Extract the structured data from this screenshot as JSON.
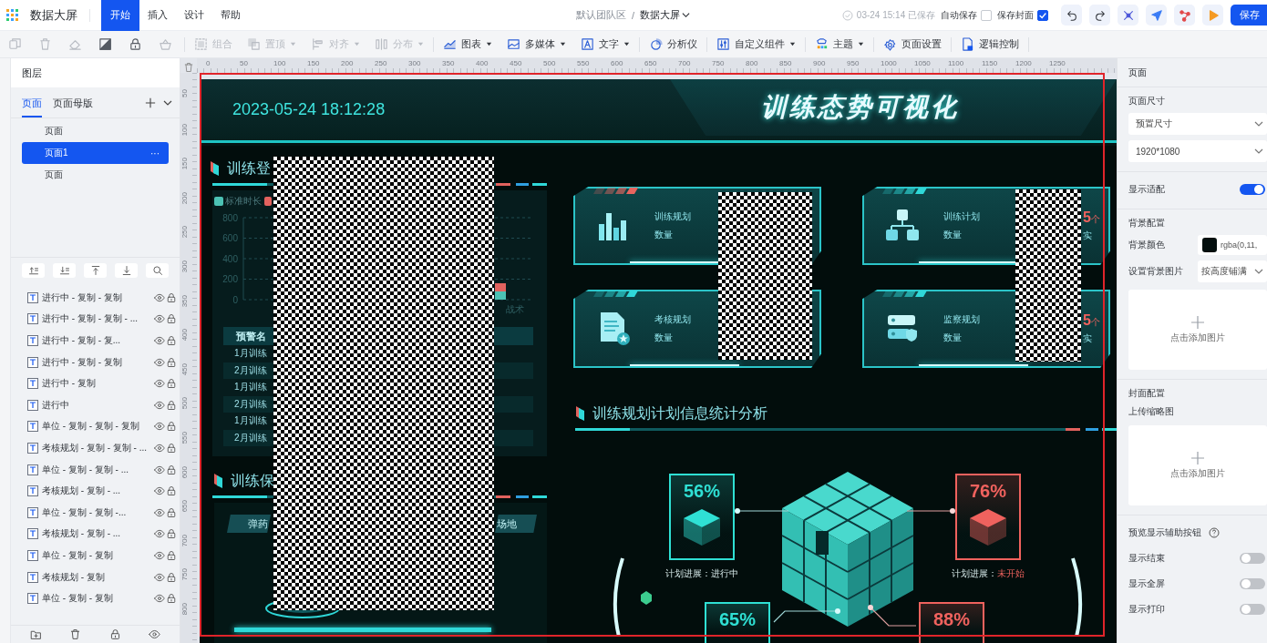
{
  "app": {
    "title": "数据大屏"
  },
  "menu_tabs": [
    {
      "label": "开始",
      "selected": true
    },
    {
      "label": "插入",
      "selected": false
    },
    {
      "label": "设计",
      "selected": false
    },
    {
      "label": "帮助",
      "selected": false
    }
  ],
  "breadcrumb": {
    "team": "默认团队区",
    "separator": "/",
    "page": "数据大屏"
  },
  "save_status": "03-24 15:14 已保存",
  "options": [
    {
      "label": "自动保存",
      "checked": false
    },
    {
      "label": "保存封面",
      "checked": true
    }
  ],
  "top_actions": [
    {
      "kind": "undo"
    },
    {
      "kind": "redo"
    },
    {
      "kind": "focus"
    },
    {
      "kind": "send"
    },
    {
      "kind": "share"
    },
    {
      "kind": "play"
    }
  ],
  "save_button": "保存",
  "toolbar": [
    {
      "items": [
        {
          "kind": "copy",
          "disabled": true
        },
        {
          "kind": "delete",
          "disabled": true
        },
        {
          "kind": "erase",
          "disabled": true
        },
        {
          "kind": "fill",
          "disabled": false
        },
        {
          "kind": "lock",
          "disabled": false
        },
        {
          "kind": "basket",
          "disabled": true
        }
      ]
    },
    {
      "items": [
        {
          "kind": "group",
          "label": "组合",
          "disabled": true
        },
        {
          "kind": "top",
          "label": "置顶",
          "dropdown": true,
          "disabled": true
        },
        {
          "kind": "align",
          "label": "对齐",
          "dropdown": true,
          "disabled": true
        },
        {
          "kind": "distribute",
          "label": "分布",
          "dropdown": true,
          "disabled": true
        }
      ]
    },
    {
      "items": [
        {
          "kind": "chart",
          "label": "图表",
          "dropdown": true,
          "disabled": false
        },
        {
          "kind": "media",
          "label": "多媒体",
          "dropdown": true,
          "disabled": false
        },
        {
          "kind": "text",
          "label": "文字",
          "dropdown": true,
          "disabled": false
        }
      ]
    },
    {
      "items": [
        {
          "kind": "analyzer",
          "label": "分析仪",
          "disabled": false
        }
      ]
    },
    {
      "items": [
        {
          "kind": "custom",
          "label": "自定义组件",
          "dropdown": true,
          "disabled": false
        }
      ]
    },
    {
      "items": [
        {
          "kind": "theme",
          "label": "主题",
          "dropdown": true,
          "disabled": false
        }
      ]
    },
    {
      "items": [
        {
          "kind": "settings",
          "label": "页面设置",
          "disabled": false
        }
      ]
    },
    {
      "items": [
        {
          "kind": "logic",
          "label": "逻辑控制",
          "disabled": false
        }
      ]
    }
  ],
  "layers_panel": {
    "title": "图层",
    "tabs": [
      {
        "label": "页面",
        "selected": true
      },
      {
        "label": "页面母版",
        "selected": false
      }
    ],
    "pages": [
      {
        "label": "页面",
        "selected": false
      },
      {
        "label": "页面1",
        "selected": true,
        "more": "···"
      },
      {
        "label": "页面",
        "selected": false
      }
    ],
    "tools": [
      {
        "kind": "up"
      },
      {
        "kind": "down"
      },
      {
        "kind": "top"
      },
      {
        "kind": "bottom"
      },
      {
        "kind": "search"
      }
    ],
    "layers": [
      {
        "label": "进行中 - 复制 - 复制"
      },
      {
        "label": "进行中 - 复制 - 复制 - ..."
      },
      {
        "label": "进行中 - 复制 - 复..."
      },
      {
        "label": "进行中 - 复制 - 复制"
      },
      {
        "label": "进行中 - 复制"
      },
      {
        "label": "进行中"
      },
      {
        "label": "单位 - 复制 - 复制 - 复制"
      },
      {
        "label": "考核规划 - 复制 - 复制 - ..."
      },
      {
        "label": "单位 - 复制 - 复制 - ..."
      },
      {
        "label": "考核规划 - 复制 - ..."
      },
      {
        "label": "单位 - 复制 - 复制 -..."
      },
      {
        "label": "考核规划 - 复制 - ..."
      },
      {
        "label": "单位 - 复制 - 复制"
      },
      {
        "label": "考核规划 - 复制"
      },
      {
        "label": "单位 - 复制 - 复制"
      }
    ]
  },
  "rulers": {
    "horizontal": [
      "0",
      "50",
      "100",
      "150",
      "200",
      "250",
      "300",
      "350",
      "400",
      "450",
      "500",
      "550",
      "600",
      "650",
      "700",
      "750",
      "800",
      "850",
      "900",
      "950",
      "1000",
      "1050",
      "1100",
      "1150",
      "1200",
      "1250"
    ],
    "vertical": [
      "50",
      "100",
      "150",
      "200",
      "250",
      "300",
      "350",
      "400",
      "450",
      "500",
      "550",
      "600",
      "650",
      "700",
      "750",
      "800"
    ]
  },
  "screen": {
    "datetime": "2023-05-24 18:12:28",
    "title": "训练态势可视化",
    "registration": {
      "title": "训练登",
      "chart_data": {
        "type": "bar",
        "stacked": true,
        "grid": true,
        "ylim": [
          0,
          800
        ],
        "yticks": [
          0,
          200,
          400,
          600,
          800
        ],
        "categories": [
          "战术"
        ],
        "series": [
          {
            "name": "标准时长",
            "color": "#4cc2b4",
            "values": [
              80
            ]
          },
          {
            "color": "#e2625e",
            "values": [
              80
            ]
          }
        ]
      },
      "table": {
        "column": "预警名",
        "rows": [
          "1月训练",
          "2月训练",
          "1月训练",
          "2月训练",
          "1月训练",
          "2月训练"
        ]
      }
    },
    "support": {
      "title": "训练保",
      "tabs": [
        "弹药",
        "场地"
      ]
    },
    "cards": [
      {
        "kind": "bars",
        "label": "训练规划",
        "sub": "数量",
        "color": "#e8655f"
      },
      {
        "kind": "hierarchy",
        "label": "训练计划",
        "sub": "数量",
        "color": "#2fd8d8",
        "value": "5",
        "unit": "个",
        "note": "实"
      },
      {
        "kind": "document",
        "label": "考核规划",
        "sub": "数量",
        "color": "#2fd8d8"
      },
      {
        "kind": "server",
        "label": "监察规划",
        "sub": "数量",
        "color": "#2fd8d8",
        "value": "5",
        "unit": "个",
        "note": "实"
      }
    ],
    "analysis": {
      "title": "训练规划计划信息统计分析",
      "gauges": [
        {
          "percent": "56%",
          "caption": "计划进展：",
          "status": "进行中",
          "color": "#2fe0d4",
          "highlight": false
        },
        {
          "percent": "76%",
          "caption": "计划进展：",
          "status": "未开始",
          "color": "#f0625e",
          "highlight": true
        },
        {
          "percent": "65%",
          "color": "#2fe0d4"
        },
        {
          "percent": "88%",
          "color": "#f0625e"
        }
      ]
    }
  },
  "properties": {
    "title": "页面",
    "size_label": "页面尺寸",
    "size_preset": "预置尺寸",
    "size_value": "1920*1080",
    "fit": {
      "label": "显示适配",
      "on": true
    },
    "background_label": "背景配置",
    "bg_color": {
      "label": "背景颜色",
      "color": "#040f0e",
      "value": "rgba(0,11,"
    },
    "bg_image": {
      "label": "设置背景图片",
      "value": "按高度铺满"
    },
    "upload_text": "点击添加图片",
    "cover_label": "封面配置",
    "thumbnail_label": "上传缩略图",
    "thumbnail_upload_text": "点击添加图片",
    "preview_label": "预览显示辅助按钮",
    "switches": [
      {
        "label": "显示结束",
        "on": false
      },
      {
        "label": "显示全屏",
        "on": false
      },
      {
        "label": "显示打印",
        "on": false
      }
    ]
  }
}
